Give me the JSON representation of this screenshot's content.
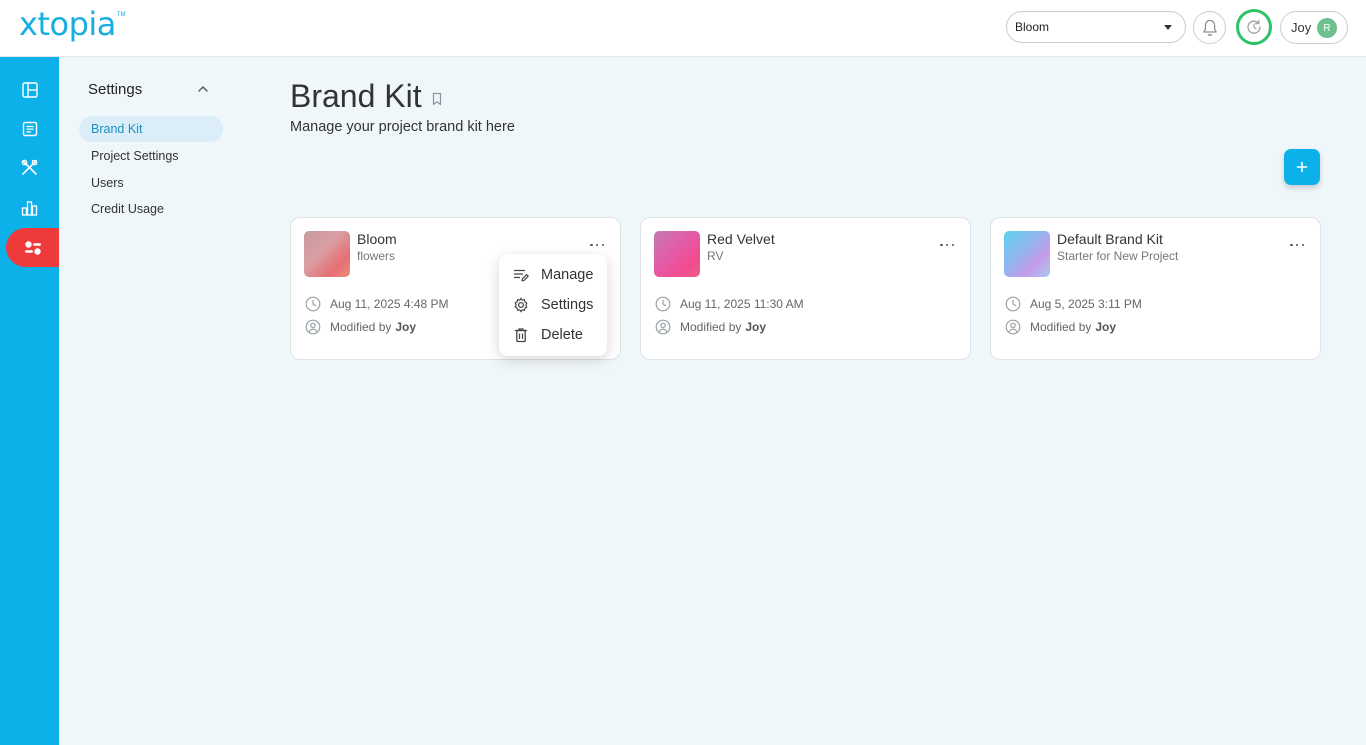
{
  "app": {
    "logo": "xtopia",
    "logo_tm": "TM"
  },
  "header": {
    "project_select": {
      "value": "Bloom"
    },
    "user": {
      "name": "Joy",
      "avatar_initial": "R"
    }
  },
  "rail": {
    "items": [
      {
        "icon": "layout-icon"
      },
      {
        "icon": "document-icon"
      },
      {
        "icon": "tools-icon"
      },
      {
        "icon": "chart-icon"
      },
      {
        "icon": "settings-sliders-icon",
        "active": true
      }
    ]
  },
  "subnav": {
    "title": "Settings",
    "items": [
      {
        "label": "Brand Kit",
        "active": true
      },
      {
        "label": "Project Settings"
      },
      {
        "label": "Users"
      },
      {
        "label": "Credit Usage"
      }
    ]
  },
  "page": {
    "title": "Brand Kit",
    "subtitle": "Manage your project brand kit here"
  },
  "cards": [
    {
      "name": "Bloom",
      "description": "flowers",
      "date": "Aug 11, 2025 4:48 PM",
      "modified_prefix": "Modified by",
      "modified_by": "Joy"
    },
    {
      "name": "Red Velvet",
      "description": "RV",
      "date": "Aug 11, 2025 11:30 AM",
      "modified_prefix": "Modified by",
      "modified_by": "Joy"
    },
    {
      "name": "Default Brand Kit",
      "description": "Starter for New Project",
      "date": "Aug 5, 2025 3:11 PM",
      "modified_prefix": "Modified by",
      "modified_by": "Joy"
    }
  ],
  "context_menu": {
    "items": [
      {
        "label": "Manage",
        "icon": "manage-icon"
      },
      {
        "label": "Settings",
        "icon": "gear-icon"
      },
      {
        "label": "Delete",
        "icon": "trash-icon"
      }
    ]
  },
  "colors": {
    "accent": "#0cb1ea",
    "rail_active": "#ee3a3a",
    "credit_ring": "#2ec269",
    "avatar": "#6cc18f"
  }
}
